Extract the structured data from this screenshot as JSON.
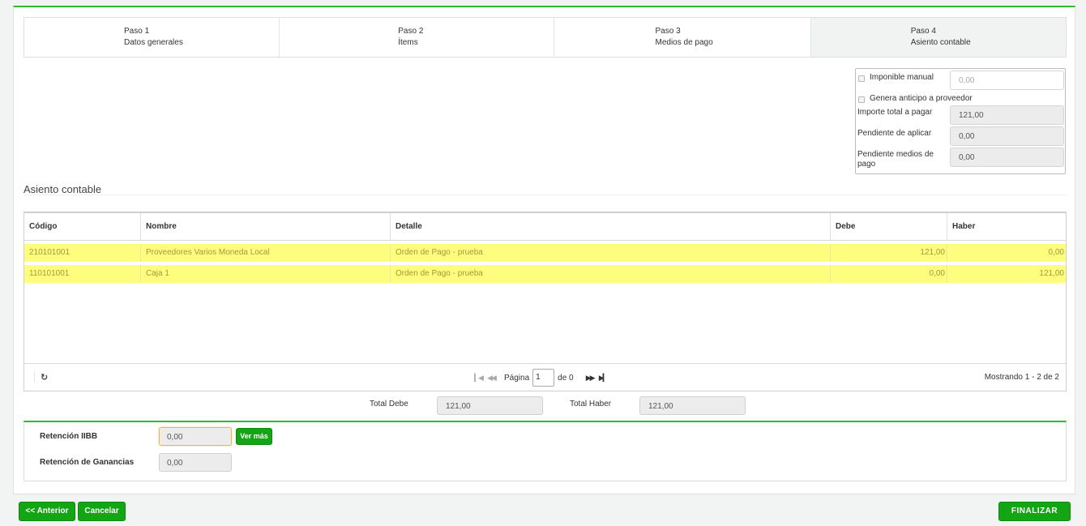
{
  "steps": [
    {
      "title": "Paso 1",
      "label": "Datos generales"
    },
    {
      "title": "Paso 2",
      "label": "Ítems"
    },
    {
      "title": "Paso 3",
      "label": "Medios de pago"
    },
    {
      "title": "Paso 4",
      "label": "Asiento contable"
    }
  ],
  "summary": {
    "imponible_label": "Imponible manual",
    "imponible_value": "0,00",
    "anticipo_label": "Genera anticipo a proveedor",
    "importe_label": "Importe total a pagar",
    "importe_value": "121,00",
    "pendiente_aplicar_label": "Pendiente de aplicar",
    "pendiente_aplicar_value": "0,00",
    "pendiente_medios_label_1": "Pendiente medios de",
    "pendiente_medios_label_2": "pago",
    "pendiente_medios_value": "0,00"
  },
  "section_title": "Asiento contable",
  "grid": {
    "columns": [
      "Código",
      "Nombre",
      "Detalle",
      "Debe",
      "Haber"
    ],
    "rows": [
      {
        "codigo": "210101001",
        "nombre": "Proveedores Varios Moneda Local",
        "detalle": "Orden de Pago - prueba",
        "debe": "121,00",
        "haber": "0,00"
      },
      {
        "codigo": "110101001",
        "nombre": "Caja 1",
        "detalle": "Orden de Pago - prueba",
        "debe": "0,00",
        "haber": "121,00"
      }
    ],
    "pager": {
      "page_label": "Página",
      "page_value": "1",
      "of_label": "de 0"
    },
    "showing": "Mostrando 1 - 2 de 2"
  },
  "totals": {
    "debe_label": "Total Debe",
    "debe_value": "121,00",
    "haber_label": "Total Haber",
    "haber_value": "121,00"
  },
  "retenciones": {
    "iibb_label": "Retención IIBB",
    "iibb_value": "0,00",
    "ver_mas": "Ver más",
    "ganancias_label": "Retención de Ganancias",
    "ganancias_value": "0,00"
  },
  "buttons": {
    "anterior": "<< Anterior",
    "cancelar": "Cancelar",
    "finalizar": "FINALIZAR"
  },
  "colors": {
    "accent": "#2dbb2d",
    "button": "#14a514",
    "row_highlight": "#fefe7e"
  }
}
